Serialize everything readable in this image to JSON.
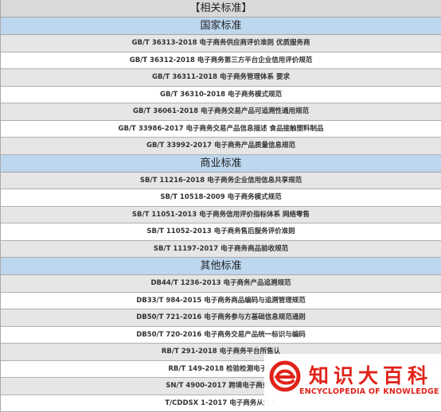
{
  "title": "【相关标准】",
  "sections": [
    {
      "name": "国家标准",
      "items": [
        "GB/T 36313-2018 电子商务供应商评价准则 优质服务商",
        "GB/T 36312-2018 电子商务第三方平台企业信用评价规范",
        "GB/T 36311-2018 电子商务管理体系 要求",
        "GB/T 36310-2018 电子商务模式规范",
        "GB/T 36061-2018 电子商务交易产品可追溯性通用规范",
        "GB/T 33986-2017 电子商务交易产品信息描述 食品接触塑料制品",
        "GB/T 33992-2017 电子商务产品质量信息规范"
      ]
    },
    {
      "name": "商业标准",
      "items": [
        "SB/T 11216-2018 电子商务企业信用信息共享规范",
        "SB/T 10518-2009 电子商务模式规范",
        "SB/T 11051-2013 电子商务信用评价指标体系 网络零售",
        "SB/T 11052-2013 电子商务售后服务评价准则",
        "SB/T 11197-2017 电子商务商品验收规范"
      ]
    },
    {
      "name": "其他标准",
      "items": [
        "DB44/T 1236-2013 电子商务产品追溯规范",
        "DB33/T 984-2015 电子商务商品编码与追溯管理规范",
        "DB50/T 721-2016 电子商务参与方基础信息规范通则",
        "DB50/T 720-2016 电子商务交易产品统一标识与编码",
        "RB/T 291-2018 电子商务平台所售认",
        "RB/T 149-2018 检验检测电子商",
        "SN/T 4900-2017 跨境电子商务产",
        "T/CDDSX 1-2017 电子商务从业人"
      ]
    }
  ],
  "watermark": {
    "cn": "知识大百科",
    "en": "ENCYCLOPEDIA OF KNOWLEDGE",
    "logo_icon": "red-e-logo",
    "color": "#e0231a"
  },
  "colors": {
    "title_bg": "#d9d9d9",
    "section_bg": "#bcd7ee",
    "odd_row_bg": "#e6e6e6",
    "even_row_bg": "#ffffff",
    "border": "#a9a9a9"
  }
}
